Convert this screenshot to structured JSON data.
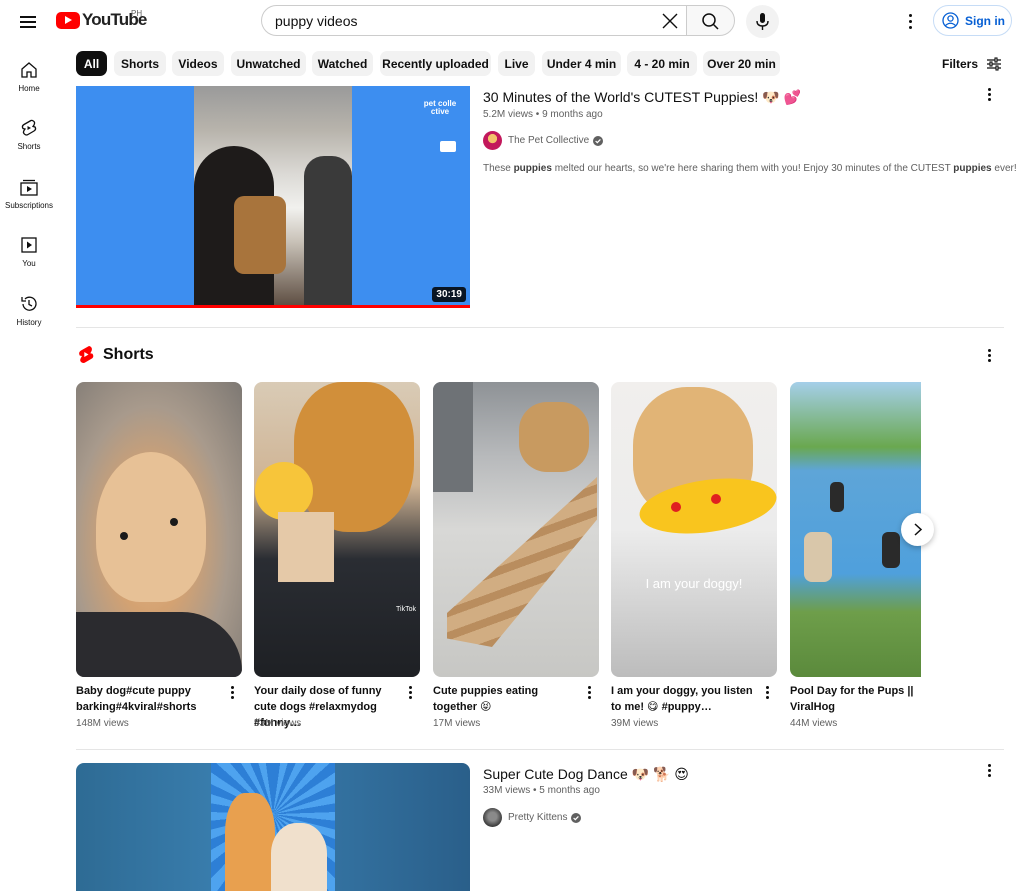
{
  "header": {
    "logo_text": "YouTube",
    "country_code": "PH",
    "search_value": "puppy videos",
    "signin_label": "Sign in"
  },
  "sidebar": {
    "items": [
      {
        "label": "Home",
        "icon": "home-icon"
      },
      {
        "label": "Shorts",
        "icon": "shorts-icon"
      },
      {
        "label": "Subscriptions",
        "icon": "subscriptions-icon"
      },
      {
        "label": "You",
        "icon": "you-icon"
      },
      {
        "label": "History",
        "icon": "history-icon"
      }
    ]
  },
  "chips": [
    "All",
    "Shorts",
    "Videos",
    "Unwatched",
    "Watched",
    "Recently uploaded",
    "Live",
    "Under 4 min",
    "4 - 20 min",
    "Over 20 min"
  ],
  "active_chip": "All",
  "filters_label": "Filters",
  "video1": {
    "title": "30 Minutes of the World's CUTEST Puppies! 🐶 💕",
    "meta": "5.2M views • 9 months ago",
    "channel": "The Pet Collective",
    "description_parts": [
      "These ",
      "puppies",
      " melted our hearts, so we're here sharing them with you! Enjoy 30 minutes of the CUTEST ",
      "puppies",
      " ever!"
    ],
    "duration": "30:19",
    "thumb_logo": "pet colle ctive",
    "watch_progress_pct": 100
  },
  "shorts": {
    "title": "Shorts",
    "items": [
      {
        "title": "Baby dog#cute puppy barking#4kviral#shorts",
        "views": "148M views"
      },
      {
        "title": "Your daily dose of funny cute dogs #relaxmydog #funny…",
        "views": "53M views"
      },
      {
        "title": "Cute puppies eating together 😝",
        "views": "17M views"
      },
      {
        "title": "I am your doggy, you listen to me! 😋 #puppy…",
        "views": "39M views"
      },
      {
        "title": "Pool Day for the Pups || ViralHog",
        "views": "44M views"
      }
    ],
    "overlay_text": "I am your doggy!",
    "tiktok_label": "TikTok"
  },
  "video2": {
    "title": "Super Cute Dog Dance 🐶 🐕 😍",
    "meta": "33M views • 5 months ago",
    "channel": "Pretty Kittens"
  },
  "colors": {
    "brand_red": "#ff0000",
    "link_blue": "#065fd4",
    "thumb1_bg": "#3d8ef0"
  }
}
